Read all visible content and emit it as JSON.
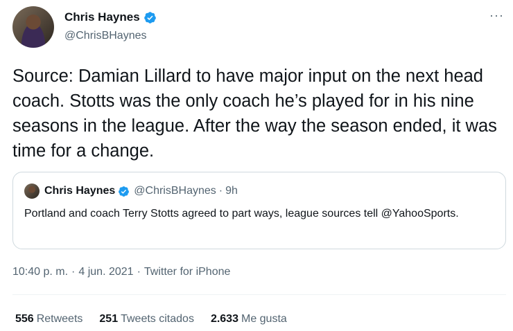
{
  "author": {
    "name": "Chris Haynes",
    "handle": "@ChrisBHaynes",
    "verified_color": "#1d9bf0"
  },
  "more_label": "···",
  "tweet": {
    "text": "Source: Damian Lillard to have major input on the next head coach. Stotts was the only coach he’s played for in his nine seasons in the league. After the way the season ended, it was time for a change."
  },
  "quote": {
    "name": "Chris Haynes",
    "handle": "@ChrisBHaynes",
    "separator": "·",
    "time": "9h",
    "text": "Portland and coach Terry Stotts agreed to part ways, league sources tell @YahooSports."
  },
  "meta": {
    "time": "10:40 p. m.",
    "dot1": "·",
    "date": "4 jun. 2021",
    "dot2": "·",
    "source": "Twitter for iPhone"
  },
  "stats": {
    "retweets_count": "556",
    "retweets_label": "Retweets",
    "quotes_count": "251",
    "quotes_label": "Tweets citados",
    "likes_count": "2.633",
    "likes_label": "Me gusta"
  }
}
